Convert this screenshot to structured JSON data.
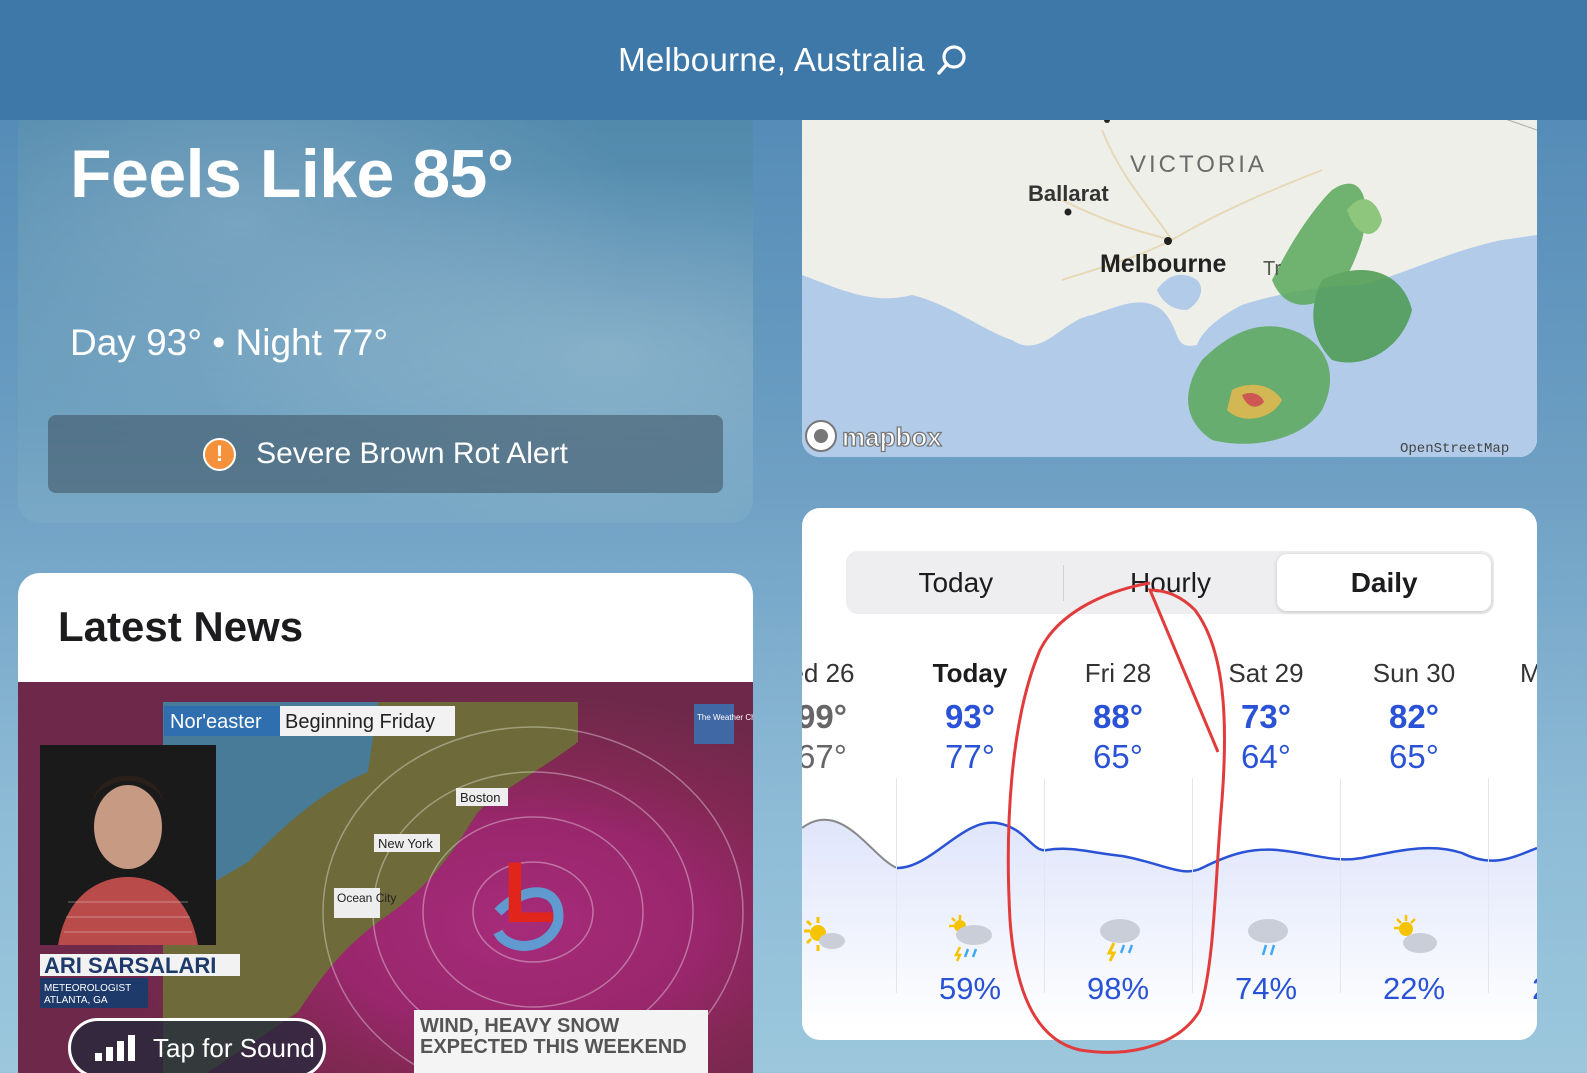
{
  "header": {
    "location": "Melbourne, Australia"
  },
  "current": {
    "feels_like": "Feels Like 85°",
    "day_night": "Day 93° • Night 77°",
    "alert_label": "Severe Brown Rot Alert"
  },
  "radar": {
    "labels": {
      "region": "VICTORIA",
      "city1": "Ballarat",
      "city2": "Melbourne",
      "city3": "Tr",
      "brand": "mapbox",
      "attribution": "OpenStreetMap"
    }
  },
  "news": {
    "title": "Latest News",
    "video": {
      "headline1": "Nor'easter",
      "headline2": "Beginning Friday",
      "presenter_name": "ARI SARSALARI",
      "presenter_title": "METEOROLOGIST",
      "presenter_location": "ATLANTA, GA",
      "city_boston": "Boston",
      "city_newyork": "New York",
      "city_ocean": "Ocean City",
      "low_marker": "L",
      "lower_third_1": "WIND, HEAVY SNOW",
      "lower_third_2": "EXPECTED THIS WEEKEND",
      "channel_logo": "The Weather Channel",
      "sound_button": "Tap for Sound"
    }
  },
  "forecast": {
    "tabs": [
      "Today",
      "Hourly",
      "Daily"
    ],
    "active_tab": "Daily",
    "days": [
      {
        "name": "ed 26",
        "high": "99°",
        "low": "67°",
        "icon": "sun-cloud-icon",
        "precip": ""
      },
      {
        "name": "Today",
        "high": "93°",
        "low": "77°",
        "icon": "sun-cloud-rain-icon",
        "precip": "59%"
      },
      {
        "name": "Fri 28",
        "high": "88°",
        "low": "65°",
        "icon": "thunderstorm-icon",
        "precip": "98%"
      },
      {
        "name": "Sat 29",
        "high": "73°",
        "low": "64°",
        "icon": "rain-cloud-icon",
        "precip": "74%"
      },
      {
        "name": "Sun 30",
        "high": "82°",
        "low": "65°",
        "icon": "partly-cloudy-icon",
        "precip": "22%"
      },
      {
        "name": "M",
        "high": "",
        "low": "",
        "icon": "",
        "precip": "2"
      }
    ]
  },
  "colors": {
    "topbar": "#3e78a8",
    "accent_blue": "#2a52d6",
    "alert_orange": "#f4913a",
    "annotation_red": "#e23b3b"
  }
}
